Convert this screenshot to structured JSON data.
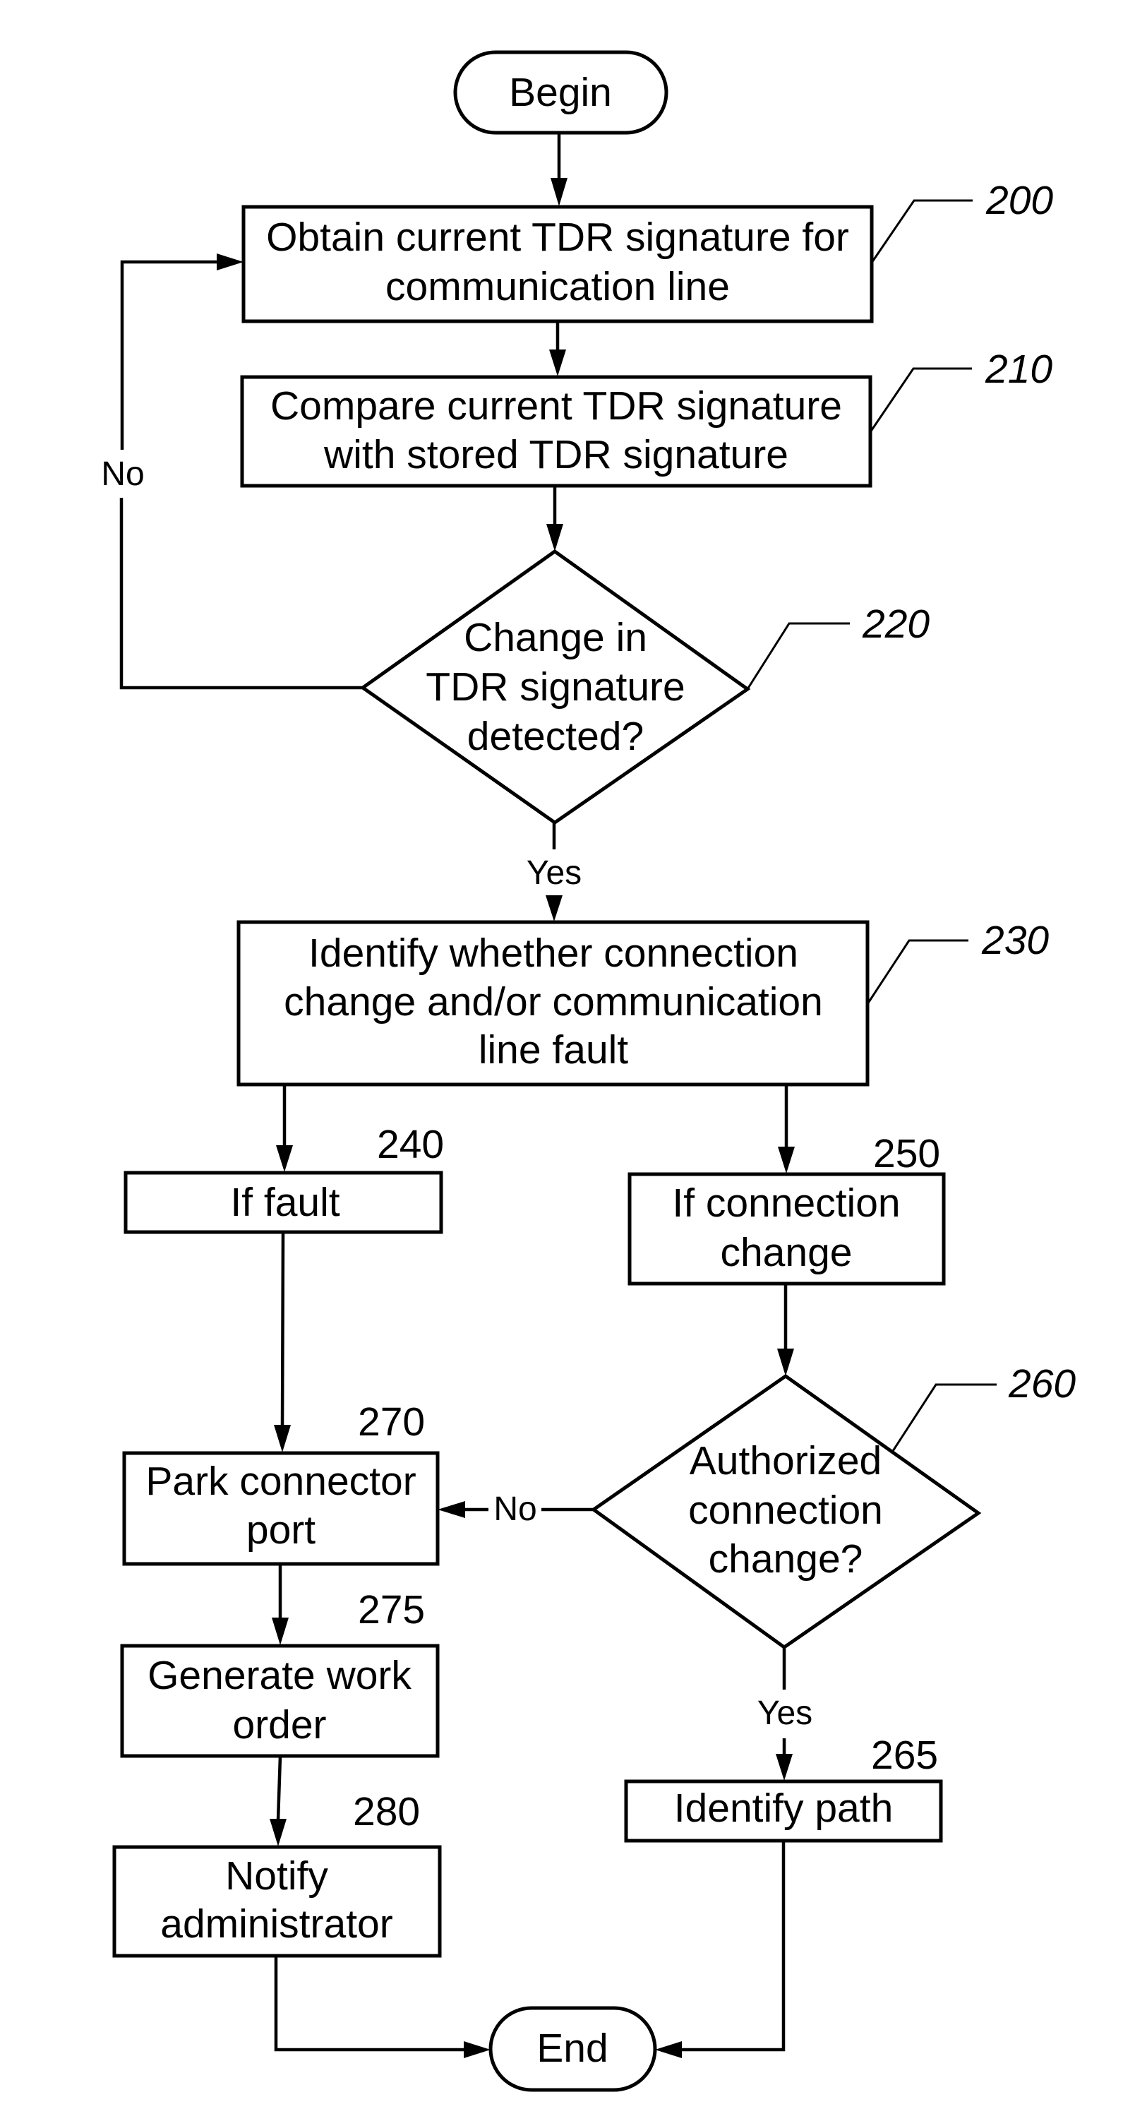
{
  "figure": {
    "type": "flowchart",
    "colors": {
      "stroke": "#000000",
      "background": "#ffffff"
    }
  },
  "terminals": {
    "begin": "Begin",
    "end": "End"
  },
  "nodes": {
    "n200": {
      "ref": "200",
      "lines": [
        "Obtain current TDR signature for",
        "communication line"
      ]
    },
    "n210": {
      "ref": "210",
      "lines": [
        "Compare current TDR signature",
        "with stored TDR signature"
      ]
    },
    "n220": {
      "ref": "220",
      "lines": [
        "Change in",
        "TDR signature",
        "detected?"
      ]
    },
    "n230": {
      "ref": "230",
      "lines": [
        "Identify whether connection",
        "change and/or communication",
        "line fault"
      ]
    },
    "n240": {
      "ref": "240",
      "lines": [
        "If fault"
      ]
    },
    "n250": {
      "ref": "250",
      "lines": [
        "If connection",
        "change"
      ]
    },
    "n260": {
      "ref": "260",
      "lines": [
        "Authorized",
        "connection",
        "change?"
      ]
    },
    "n265": {
      "ref": "265",
      "lines": [
        "Identify path"
      ]
    },
    "n270": {
      "ref": "270",
      "lines": [
        "Park connector",
        "port"
      ]
    },
    "n275": {
      "ref": "275",
      "lines": [
        "Generate work",
        "order"
      ]
    },
    "n280": {
      "ref": "280",
      "lines": [
        "Notify",
        "administrator"
      ]
    }
  },
  "edge_labels": {
    "n220_no": "No",
    "n220_yes": "Yes",
    "n260_no": "No",
    "n260_yes": "Yes"
  },
  "edges": [
    {
      "from": "begin",
      "to": "n200"
    },
    {
      "from": "n200",
      "to": "n210"
    },
    {
      "from": "n210",
      "to": "n220"
    },
    {
      "from": "n220",
      "to": "n200",
      "label": "No"
    },
    {
      "from": "n220",
      "to": "n230",
      "label": "Yes"
    },
    {
      "from": "n230",
      "to": "n240"
    },
    {
      "from": "n230",
      "to": "n250"
    },
    {
      "from": "n240",
      "to": "n270"
    },
    {
      "from": "n250",
      "to": "n260"
    },
    {
      "from": "n260",
      "to": "n270",
      "label": "No"
    },
    {
      "from": "n260",
      "to": "n265",
      "label": "Yes"
    },
    {
      "from": "n270",
      "to": "n275"
    },
    {
      "from": "n275",
      "to": "n280"
    },
    {
      "from": "n280",
      "to": "end"
    },
    {
      "from": "n265",
      "to": "end"
    }
  ]
}
